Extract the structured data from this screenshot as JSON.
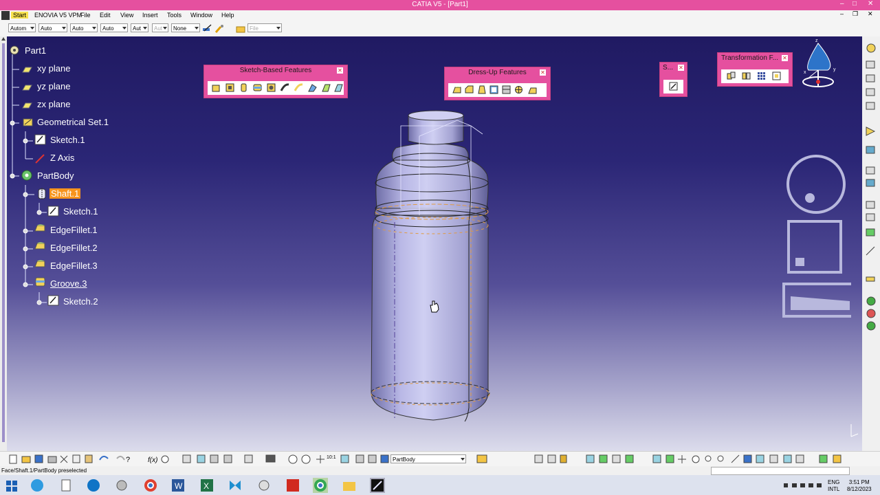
{
  "window": {
    "title": "CATIA V5 - [Part1]"
  },
  "menu": [
    "Start",
    "ENOVIA V5 VPM",
    "File",
    "Edit",
    "View",
    "Insert",
    "Tools",
    "Window",
    "Help"
  ],
  "toolbar": {
    "combos": [
      "Autom",
      "Auto",
      "Auto",
      "Auto",
      "Aut",
      "Aut",
      "None"
    ],
    "file_combo": "File"
  },
  "tree": {
    "root": "Part1",
    "nodes": [
      "xy plane",
      "yz plane",
      "zx plane",
      "Geometrical Set.1",
      "Sketch.1",
      "Z Axis",
      "PartBody",
      "Shaft.1",
      "Sketch.1",
      "EdgeFillet.1",
      "EdgeFillet.2",
      "EdgeFillet.3",
      "Groove.3",
      "Sketch.2"
    ]
  },
  "panels": {
    "sketch_based": "Sketch-Based Features",
    "dress_up": "Dress-Up Features",
    "small": "S...",
    "transformation": "Transformation F..."
  },
  "axis_labels": {
    "x": "x",
    "y": "y",
    "z": "z"
  },
  "bottom": {
    "current_body": "PartBody"
  },
  "status": {
    "text": "Face/Shaft.1/PartBody preselected"
  },
  "taskbar": {
    "lang1": "ENG",
    "lang2": "INTL",
    "time": "3:51 PM",
    "date": "8/12/2023"
  },
  "colors": {
    "title": "#e5509f",
    "viewport_top": "#201a62",
    "selection": "#f7941d"
  }
}
